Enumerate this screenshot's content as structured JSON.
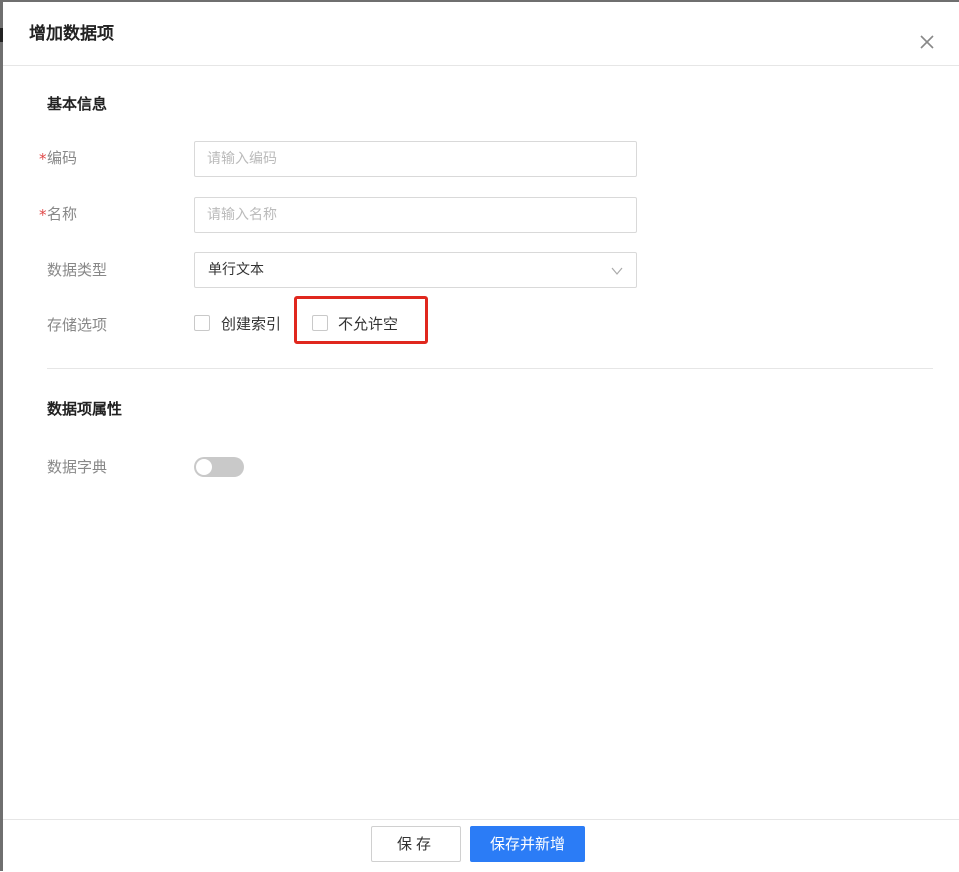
{
  "dialog": {
    "title": "增加数据项"
  },
  "sections": {
    "basic": "基本信息",
    "properties": "数据项属性"
  },
  "fields": {
    "code": {
      "required_mark": "*",
      "label": "编码",
      "placeholder": "请输入编码",
      "value": ""
    },
    "name": {
      "required_mark": "*",
      "label": "名称",
      "placeholder": "请输入名称",
      "value": ""
    },
    "data_type": {
      "label": "数据类型",
      "value": "单行文本"
    },
    "storage": {
      "label": "存储选项",
      "options": [
        {
          "label": "创建索引",
          "checked": false
        },
        {
          "label": "不允许空",
          "checked": false
        }
      ]
    },
    "dictionary": {
      "label": "数据字典",
      "enabled": false
    }
  },
  "footer": {
    "save_label": "保存",
    "save_and_new_label": "保存并新增"
  },
  "colors": {
    "primary": "#2b7cf6",
    "required": "#e04848",
    "highlight": "#e0281e"
  },
  "icons": {
    "close": "close-icon",
    "select_arrow": "chevron-down-icon"
  }
}
